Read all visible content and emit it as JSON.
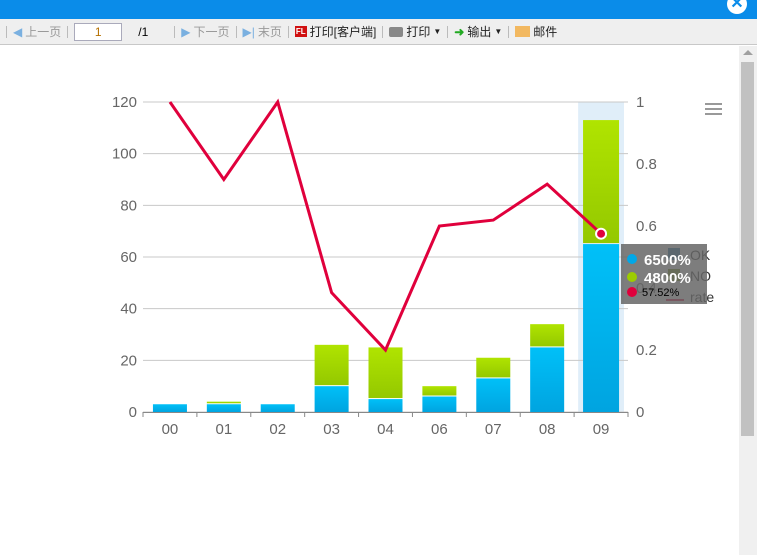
{
  "window": {
    "close_icon": "close-icon"
  },
  "toolbar": {
    "prev": "上一页",
    "page": "1",
    "total": "/1",
    "next": "下一页",
    "last": "末页",
    "print_client": "打印[客户端]",
    "print": "打印",
    "export": "输出",
    "mail": "邮件"
  },
  "tooltip": {
    "ok": "6500%",
    "no": "4800%",
    "rate": "57.52%"
  },
  "chart_data": {
    "type": "bar",
    "stacked": true,
    "categories": [
      "00",
      "01",
      "02",
      "03",
      "04",
      "06",
      "07",
      "08",
      "09"
    ],
    "series": [
      {
        "name": "OK",
        "type": "bar",
        "axis": "left",
        "color": "#00b4f0",
        "values": [
          3,
          3,
          3,
          10,
          5,
          6,
          13,
          25,
          65
        ]
      },
      {
        "name": "NO",
        "type": "bar",
        "axis": "left",
        "color": "#a8d800",
        "values": [
          0,
          1,
          0,
          16,
          20,
          4,
          8,
          9,
          48
        ]
      },
      {
        "name": "rate",
        "type": "line",
        "axis": "right",
        "color": "#e0003c",
        "values": [
          1,
          0.75,
          1,
          0.385,
          0.2,
          0.6,
          0.619,
          0.735,
          0.5752
        ]
      }
    ],
    "ylim": [
      0,
      120
    ],
    "yticks": [
      "0",
      "20",
      "40",
      "60",
      "80",
      "100",
      "120"
    ],
    "y2lim": [
      0,
      1
    ],
    "y2ticks": [
      "0",
      "0.2",
      "0.4",
      "0.6",
      "0.8",
      "1"
    ],
    "legend": [
      "OK",
      "NO",
      "rate"
    ],
    "legend_position": "right",
    "highlighted": "09"
  }
}
